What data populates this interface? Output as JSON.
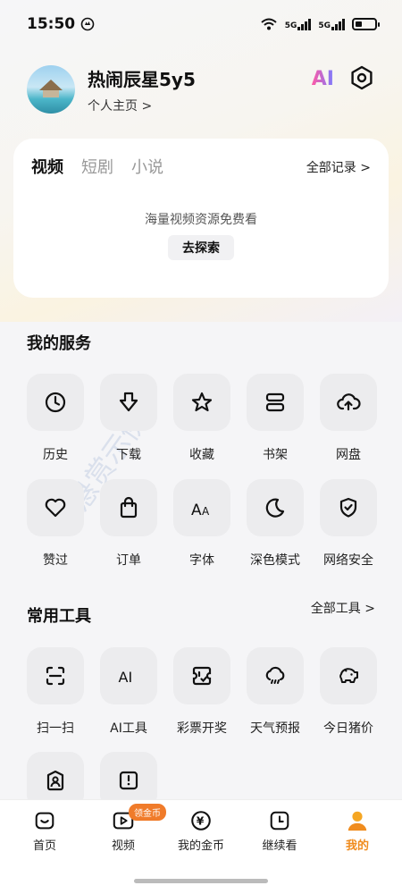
{
  "status_bar": {
    "time": "15:50",
    "network_1": "5G",
    "network_2": "5G",
    "battery_level": 0.35
  },
  "profile": {
    "name": "热闹辰星5y5",
    "homepage_link": "个人主页 >",
    "ai_label": "AI"
  },
  "record_card": {
    "tabs": [
      "视频",
      "短剧",
      "小说"
    ],
    "active_tab": 0,
    "all_records": "全部记录 >",
    "empty_text": "海量视频资源免费看",
    "explore_button": "去探索"
  },
  "my_services": {
    "title": "我的服务",
    "items": [
      {
        "label": "历史",
        "icon": "clock-icon"
      },
      {
        "label": "下载",
        "icon": "download-icon"
      },
      {
        "label": "收藏",
        "icon": "star-icon"
      },
      {
        "label": "书架",
        "icon": "bookshelf-icon"
      },
      {
        "label": "网盘",
        "icon": "cloud-upload-icon"
      },
      {
        "label": "赞过",
        "icon": "heart-icon"
      },
      {
        "label": "订单",
        "icon": "shopping-bag-icon"
      },
      {
        "label": "字体",
        "icon": "font-icon"
      },
      {
        "label": "深色模式",
        "icon": "moon-icon"
      },
      {
        "label": "网络安全",
        "icon": "shield-check-icon"
      }
    ]
  },
  "common_tools": {
    "title": "常用工具",
    "all_tools": "全部工具 >",
    "items": [
      {
        "label": "扫一扫",
        "icon": "scan-icon"
      },
      {
        "label": "AI工具",
        "icon": "ai-icon"
      },
      {
        "label": "彩票开奖",
        "icon": "lottery-icon"
      },
      {
        "label": "天气预报",
        "icon": "weather-icon"
      },
      {
        "label": "今日猪价",
        "icon": "piggy-icon"
      },
      {
        "label": "",
        "icon": "contact-book-icon"
      },
      {
        "label": "",
        "icon": "notice-icon"
      }
    ]
  },
  "bottom_nav": {
    "items": [
      {
        "label": "首页",
        "icon": "home-icon"
      },
      {
        "label": "视频",
        "icon": "video-icon",
        "badge": "领金币"
      },
      {
        "label": "我的金币",
        "icon": "coin-icon"
      },
      {
        "label": "继续看",
        "icon": "continue-watch-icon"
      },
      {
        "label": "我的",
        "icon": "profile-icon"
      }
    ],
    "active_index": 4
  },
  "colors": {
    "accent": "#f08c1e",
    "badge": "#f07b2a",
    "icon_bg": "#ececee"
  }
}
